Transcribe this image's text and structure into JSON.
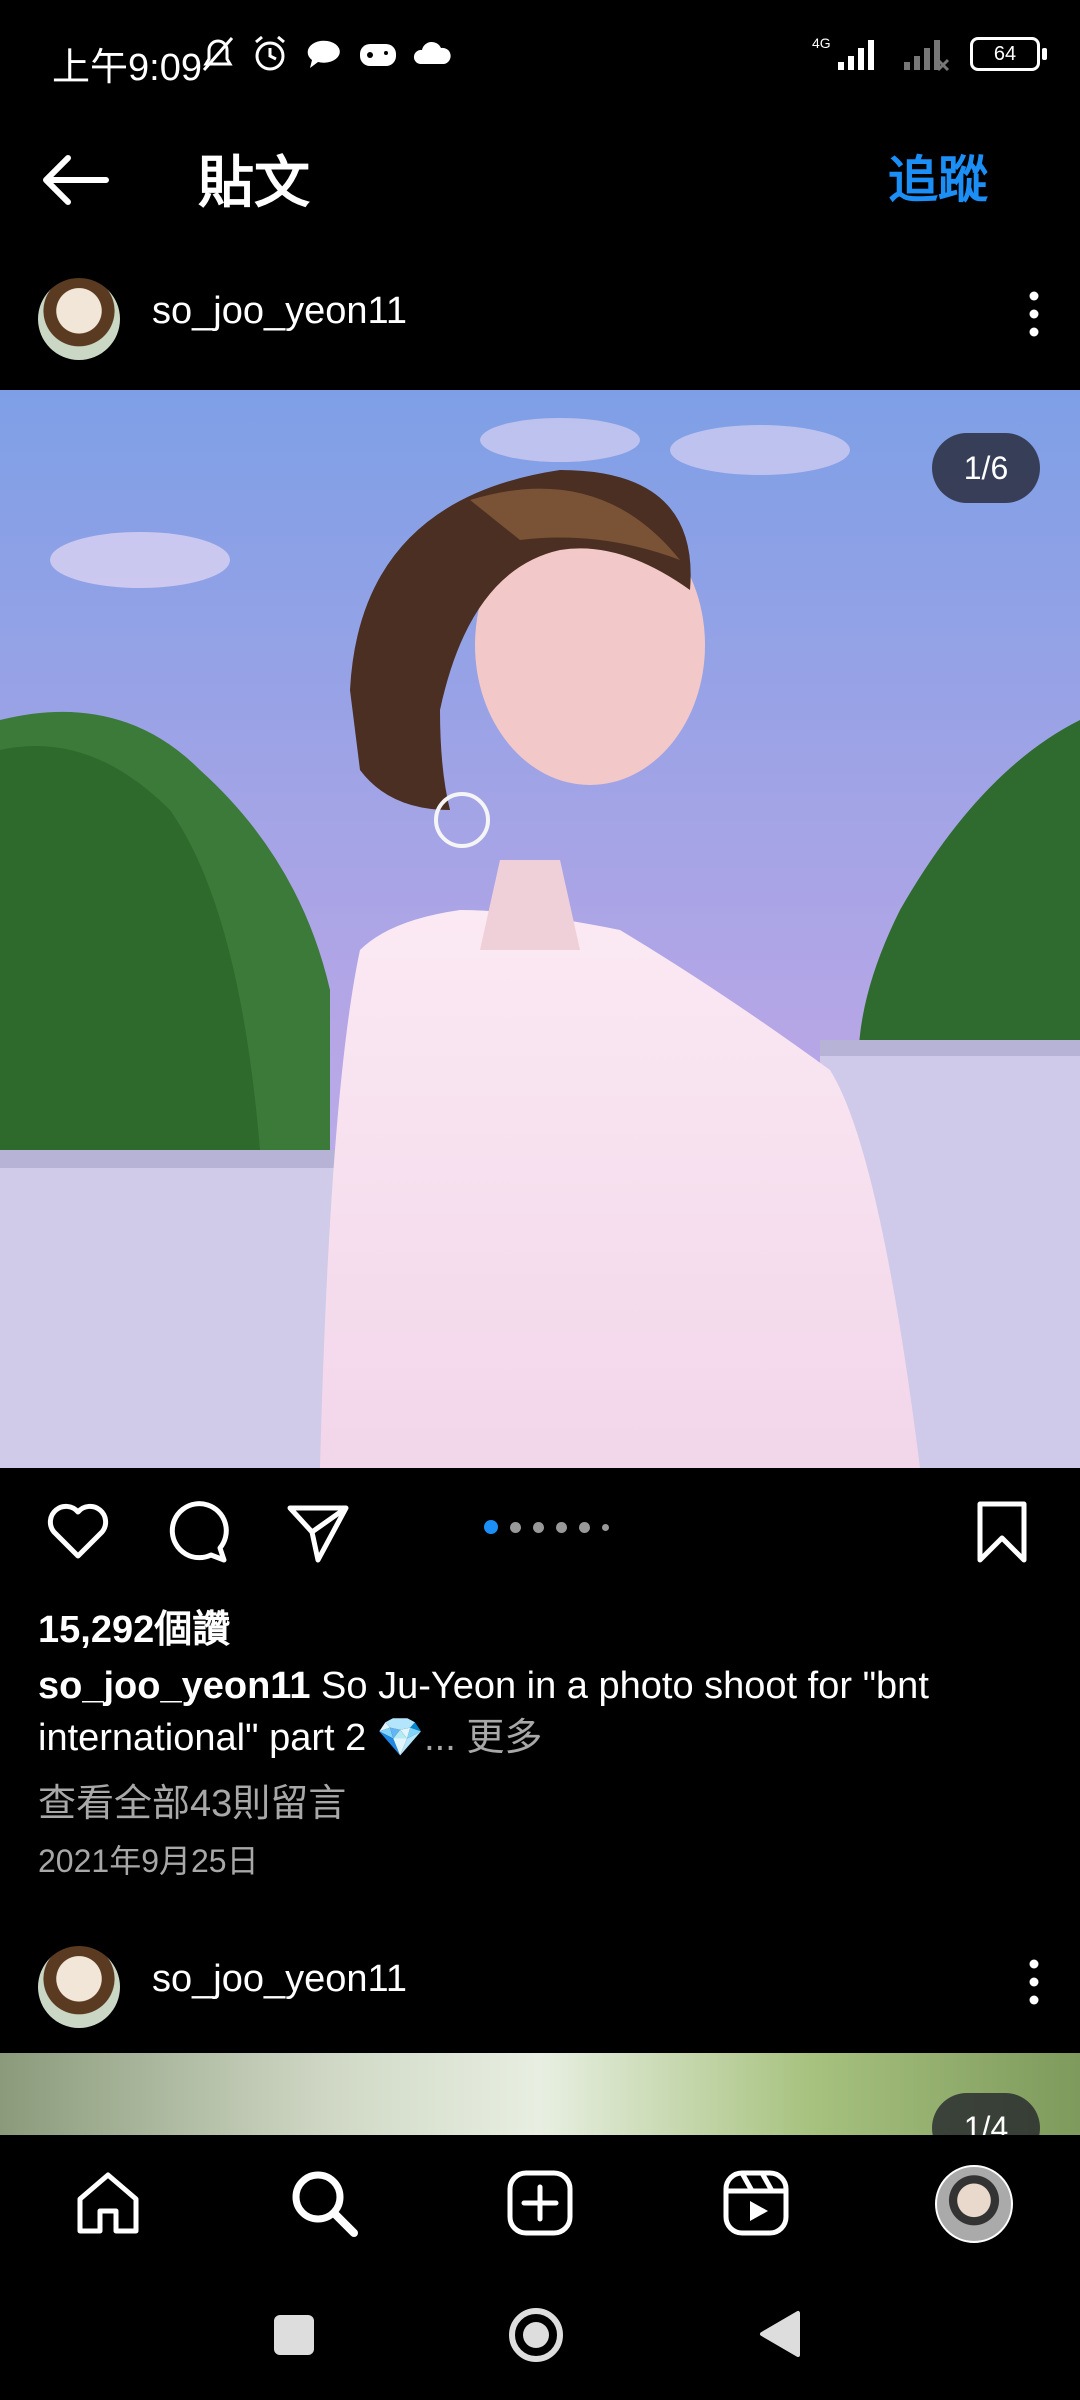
{
  "status_bar": {
    "time": "上午9:09",
    "network": "4G",
    "battery": "64"
  },
  "header": {
    "title": "貼文",
    "follow_label": "追蹤"
  },
  "post": {
    "username": "so_joo_yeon11",
    "page_indicator": "1/6",
    "likes": "15,292個讚",
    "caption_user": "so_joo_yeon11",
    "caption_text": " So Ju-Yeon in a photo shoot for \"bnt international\" part 2 💎",
    "caption_more": "... 更多",
    "comments_link": "查看全部43則留言",
    "date": "2021年9月25日"
  },
  "next_post": {
    "username": "so_joo_yeon11",
    "page_indicator": "1/4"
  },
  "colors": {
    "accent": "#1b8ff5",
    "secondary_text": "#a8a8a8",
    "background": "#000000"
  },
  "icons": {
    "back": "arrow-left-icon",
    "more": "more-vertical-icon",
    "like": "heart-icon",
    "comment": "comment-icon",
    "share": "send-icon",
    "save": "bookmark-icon",
    "nav": [
      "home-icon",
      "search-icon",
      "add-icon",
      "reels-icon",
      "profile-avatar"
    ]
  }
}
